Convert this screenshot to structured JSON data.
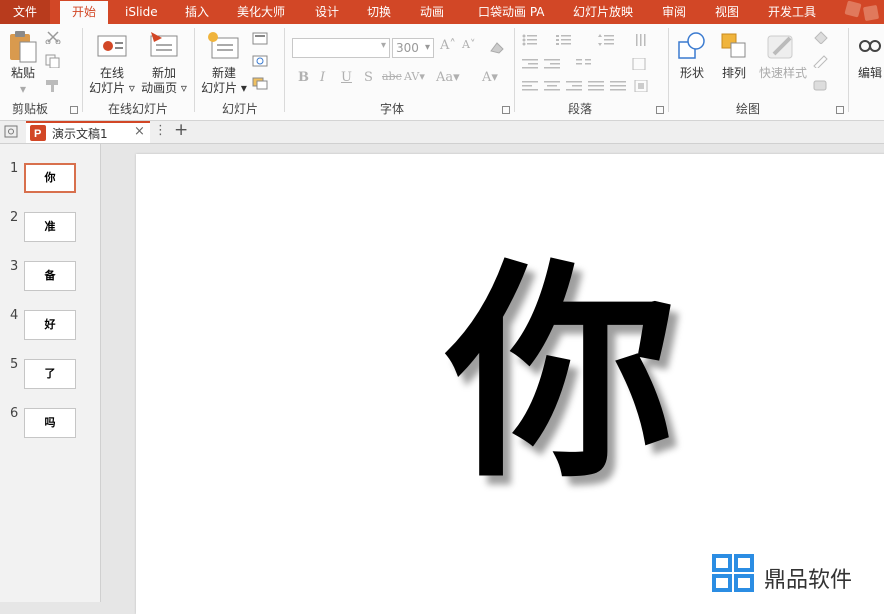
{
  "tabs": {
    "file": "文件",
    "home": "开始",
    "islide": "iSlide",
    "insert": "插入",
    "beautify": "美化大师",
    "design": "设计",
    "transitions": "切换",
    "animations": "动画",
    "pocket": "口袋动画 PA",
    "slideshow": "幻灯片放映",
    "review": "审阅",
    "view": "视图",
    "developer": "开发工具"
  },
  "ribbon": {
    "paste_label": "粘贴",
    "clipboard_group": "剪贴板",
    "online_slides_line1": "在线",
    "online_slides_line2": "幻灯片",
    "new_anim_line1": "新加",
    "new_anim_line2": "动画页",
    "online_group": "在线幻灯片",
    "new_slide_line1": "新建",
    "new_slide_line2": "幻灯片",
    "slides_group": "幻灯片",
    "font_size": "300",
    "font_group": "字体",
    "paragraph_group": "段落",
    "shapes_label": "形状",
    "arrange_label": "排列",
    "quick_styles_label": "快速样式",
    "drawing_group": "绘图",
    "edit_label": "编辑",
    "bold": "B",
    "italic": "I",
    "underline": "U",
    "shadow": "S",
    "strike": "abc",
    "spacing": "AV",
    "case": "Aa",
    "grow": "A",
    "shrink": "A",
    "color_a": "A"
  },
  "doc_tab": {
    "title": "演示文稿1",
    "close": "×",
    "more": "⋮",
    "add": "+"
  },
  "thumbnails": [
    {
      "num": "1",
      "char": "你"
    },
    {
      "num": "2",
      "char": "准"
    },
    {
      "num": "3",
      "char": "备"
    },
    {
      "num": "4",
      "char": "好"
    },
    {
      "num": "5",
      "char": "了"
    },
    {
      "num": "6",
      "char": "吗"
    }
  ],
  "slide": {
    "main_char": "你"
  },
  "watermark": {
    "text": "鼎品软件"
  },
  "colors": {
    "accent": "#d24726",
    "file_tab": "#b83b1d",
    "watermark_blue": "#2b8de3"
  }
}
